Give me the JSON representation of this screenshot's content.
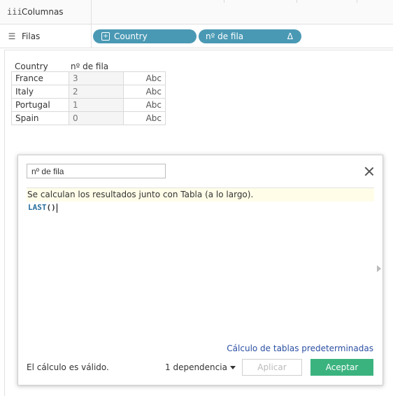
{
  "shelves": {
    "columns_label": "Columnas",
    "columns_icon": "columns-icon",
    "rows_label": "Filas",
    "rows_icon": "rows-icon",
    "pills": [
      {
        "label": "Country",
        "icon": "plus-box-icon"
      },
      {
        "label": "nº de fila",
        "icon": "delta-icon",
        "icon_glyph": "Δ"
      }
    ]
  },
  "viz": {
    "headers": [
      "Country",
      "nº de fila"
    ],
    "rows": [
      {
        "country": "France",
        "value": "3",
        "mark": "Abc"
      },
      {
        "country": "Italy",
        "value": "2",
        "mark": "Abc"
      },
      {
        "country": "Portugal",
        "value": "1",
        "mark": "Abc"
      },
      {
        "country": "Spain",
        "value": "0",
        "mark": "Abc"
      }
    ]
  },
  "dialog": {
    "name_value": "nº de fila",
    "info": "Se calculan los resultados junto con Tabla (a lo largo).",
    "formula_fn": "LAST",
    "formula_paren": "()",
    "default_link": "Cálculo de tablas predeterminadas",
    "status": "El cálculo es válido.",
    "dependency": "1 dependencia",
    "apply_label": "Aplicar",
    "ok_label": "Aceptar"
  },
  "colors": {
    "pill": "#4a99b4",
    "accept": "#3bb37f",
    "link": "#2b4fa2",
    "info_bg": "#fffde8"
  }
}
